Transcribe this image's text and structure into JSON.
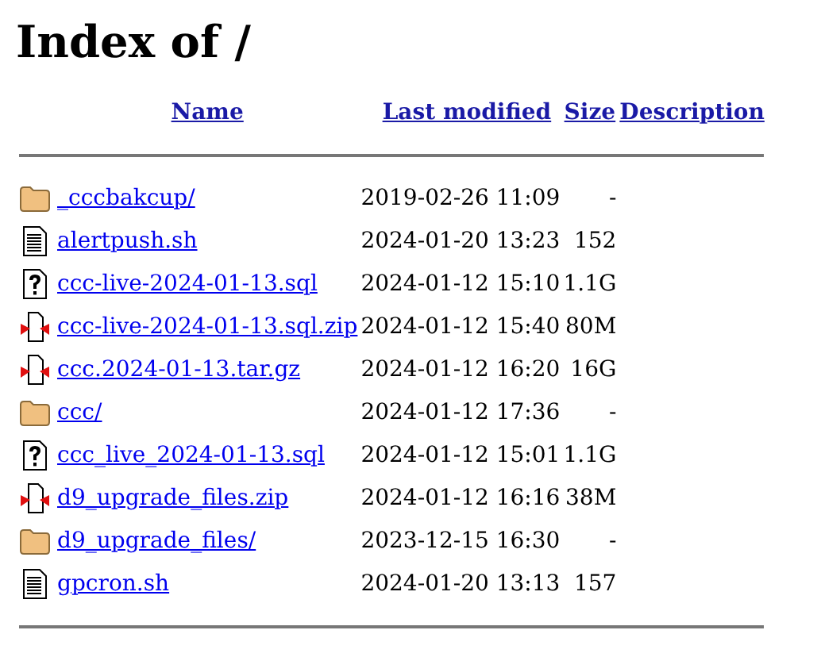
{
  "title": "Index of /",
  "columns": [
    "Name",
    "Last modified",
    "Size",
    "Description"
  ],
  "rows": [
    {
      "kind": "folder",
      "name": "_cccbakcup/",
      "modified": "2019-02-26 11:09",
      "size": "-"
    },
    {
      "kind": "text",
      "name": "alertpush.sh",
      "modified": "2024-01-20 13:23",
      "size": "152"
    },
    {
      "kind": "unknown",
      "name": "ccc-live-2024-01-13.sql",
      "modified": "2024-01-12 15:10",
      "size": "1.1G"
    },
    {
      "kind": "compressed",
      "name": "ccc-live-2024-01-13.sql.zip",
      "modified": "2024-01-12 15:40",
      "size": "80M"
    },
    {
      "kind": "compressed",
      "name": "ccc.2024-01-13.tar.gz",
      "modified": "2024-01-12 16:20",
      "size": "16G"
    },
    {
      "kind": "folder",
      "name": "ccc/",
      "modified": "2024-01-12 17:36",
      "size": "-"
    },
    {
      "kind": "unknown",
      "name": "ccc_live_2024-01-13.sql",
      "modified": "2024-01-12 15:01",
      "size": "1.1G"
    },
    {
      "kind": "compressed",
      "name": "d9_upgrade_files.zip",
      "modified": "2024-01-12 16:16",
      "size": "38M"
    },
    {
      "kind": "folder",
      "name": "d9_upgrade_files/",
      "modified": "2023-12-15 16:30",
      "size": "-"
    },
    {
      "kind": "text",
      "name": "gpcron.sh",
      "modified": "2024-01-20 13:13",
      "size": "157"
    }
  ]
}
